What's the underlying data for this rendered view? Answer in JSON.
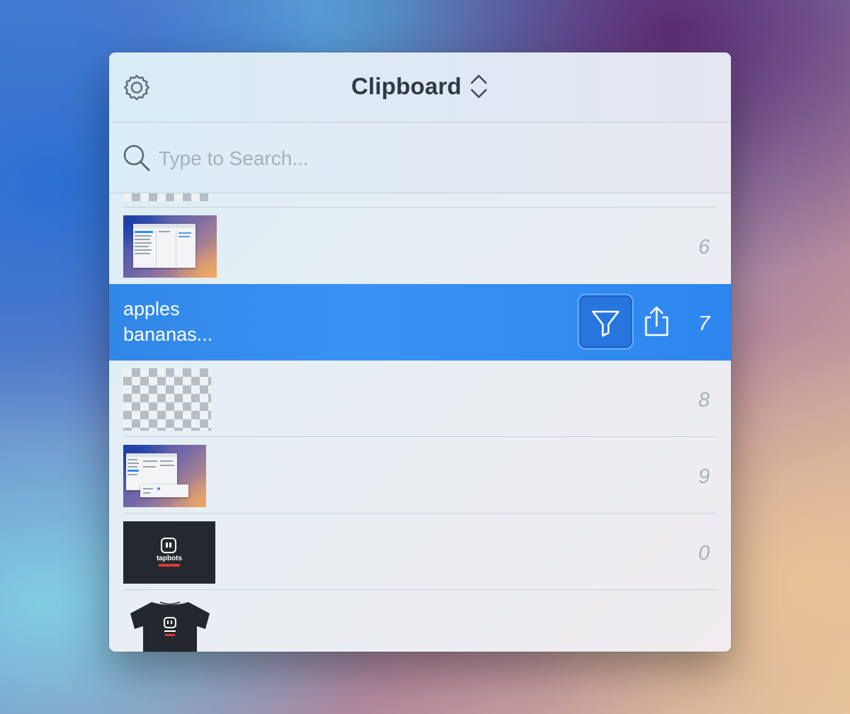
{
  "header": {
    "title": "Clipboard"
  },
  "search": {
    "placeholder": "Type to Search..."
  },
  "items": [
    {
      "type": "image",
      "shortcut": "6"
    },
    {
      "type": "text",
      "line1": "apples",
      "line2": "bananas...",
      "shortcut": "7",
      "selected": true
    },
    {
      "type": "image",
      "shortcut": "8"
    },
    {
      "type": "image",
      "shortcut": "9"
    },
    {
      "type": "image",
      "shortcut": "0"
    },
    {
      "type": "image",
      "shortcut": ""
    }
  ],
  "thumbs": {
    "brand_text": "tapbots"
  },
  "colors": {
    "accent": "#3187e6",
    "title_text": "#2c3a44",
    "shortcut_text": "#a9b1b8"
  }
}
